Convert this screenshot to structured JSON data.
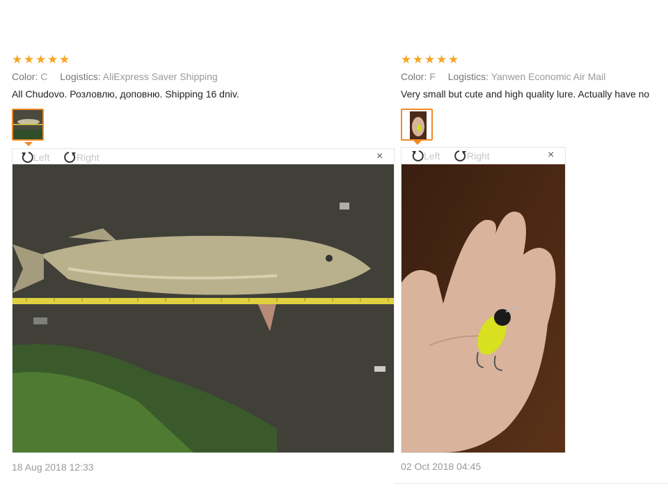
{
  "reviews": [
    {
      "rating": 5,
      "color_label": "Color:",
      "color_value": "C",
      "logistics_label": "Logistics:",
      "logistics_value": "AliExpress Saver Shipping",
      "text": "All Chudovo. Розловлю, доповню. Shipping 16 dniv.",
      "rotate_left": "Left",
      "rotate_right": "Right",
      "close": "×",
      "date": "18 Aug 2018 12:33",
      "photo": "pike-fish-on-ground-with-measuring-tape"
    },
    {
      "rating": 5,
      "color_label": "Color:",
      "color_value": "F",
      "logistics_label": "Logistics:",
      "logistics_value": "Yanwen Economic Air Mail",
      "text": "Very small but cute and high quality lure. Actually have no",
      "rotate_left": "Left",
      "rotate_right": "Right",
      "close": "×",
      "date": "02 Oct 2018 04:45",
      "photo": "hand-holding-yellow-fishing-lure"
    }
  ],
  "icons": {
    "star": "star-icon",
    "rotate_left": "rotate-left-icon",
    "rotate_right": "rotate-right-icon",
    "close": "close-icon"
  },
  "colors": {
    "star": "#f5a623",
    "thumb_border": "#f08a24",
    "meta": "#999999"
  }
}
